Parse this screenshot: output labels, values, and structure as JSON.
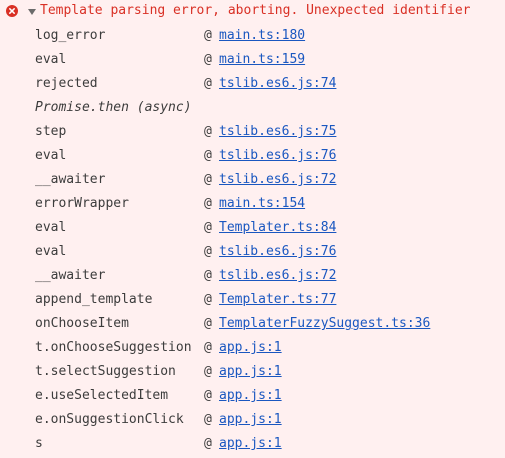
{
  "header": {
    "icon": "error-circle-icon",
    "message": "Template parsing error, aborting. Unexpected identifier"
  },
  "colors": {
    "background": "#fff0f0",
    "error": "#d93025",
    "link": "#1a57c0",
    "text": "#3c3c3c"
  },
  "frames": [
    {
      "fn": "log_error",
      "at": "@",
      "loc": "main.ts:180"
    },
    {
      "fn": "eval",
      "at": "@",
      "loc": "main.ts:159"
    },
    {
      "fn": "rejected",
      "at": "@",
      "loc": "tslib.es6.js:74"
    },
    {
      "fn": "Promise.then (async)",
      "async": true
    },
    {
      "fn": "step",
      "at": "@",
      "loc": "tslib.es6.js:75"
    },
    {
      "fn": "eval",
      "at": "@",
      "loc": "tslib.es6.js:76"
    },
    {
      "fn": "__awaiter",
      "at": "@",
      "loc": "tslib.es6.js:72"
    },
    {
      "fn": "errorWrapper",
      "at": "@",
      "loc": "main.ts:154"
    },
    {
      "fn": "eval",
      "at": "@",
      "loc": "Templater.ts:84"
    },
    {
      "fn": "eval",
      "at": "@",
      "loc": "tslib.es6.js:76"
    },
    {
      "fn": "__awaiter",
      "at": "@",
      "loc": "tslib.es6.js:72"
    },
    {
      "fn": "append_template",
      "at": "@",
      "loc": "Templater.ts:77"
    },
    {
      "fn": "onChooseItem",
      "at": "@",
      "loc": "TemplaterFuzzySuggest.ts:36"
    },
    {
      "fn": "t.onChooseSuggestion",
      "at": "@",
      "loc": "app.js:1"
    },
    {
      "fn": "t.selectSuggestion",
      "at": "@",
      "loc": "app.js:1"
    },
    {
      "fn": "e.useSelectedItem",
      "at": "@",
      "loc": "app.js:1"
    },
    {
      "fn": "e.onSuggestionClick",
      "at": "@",
      "loc": "app.js:1"
    },
    {
      "fn": "s",
      "at": "@",
      "loc": "app.js:1"
    }
  ]
}
